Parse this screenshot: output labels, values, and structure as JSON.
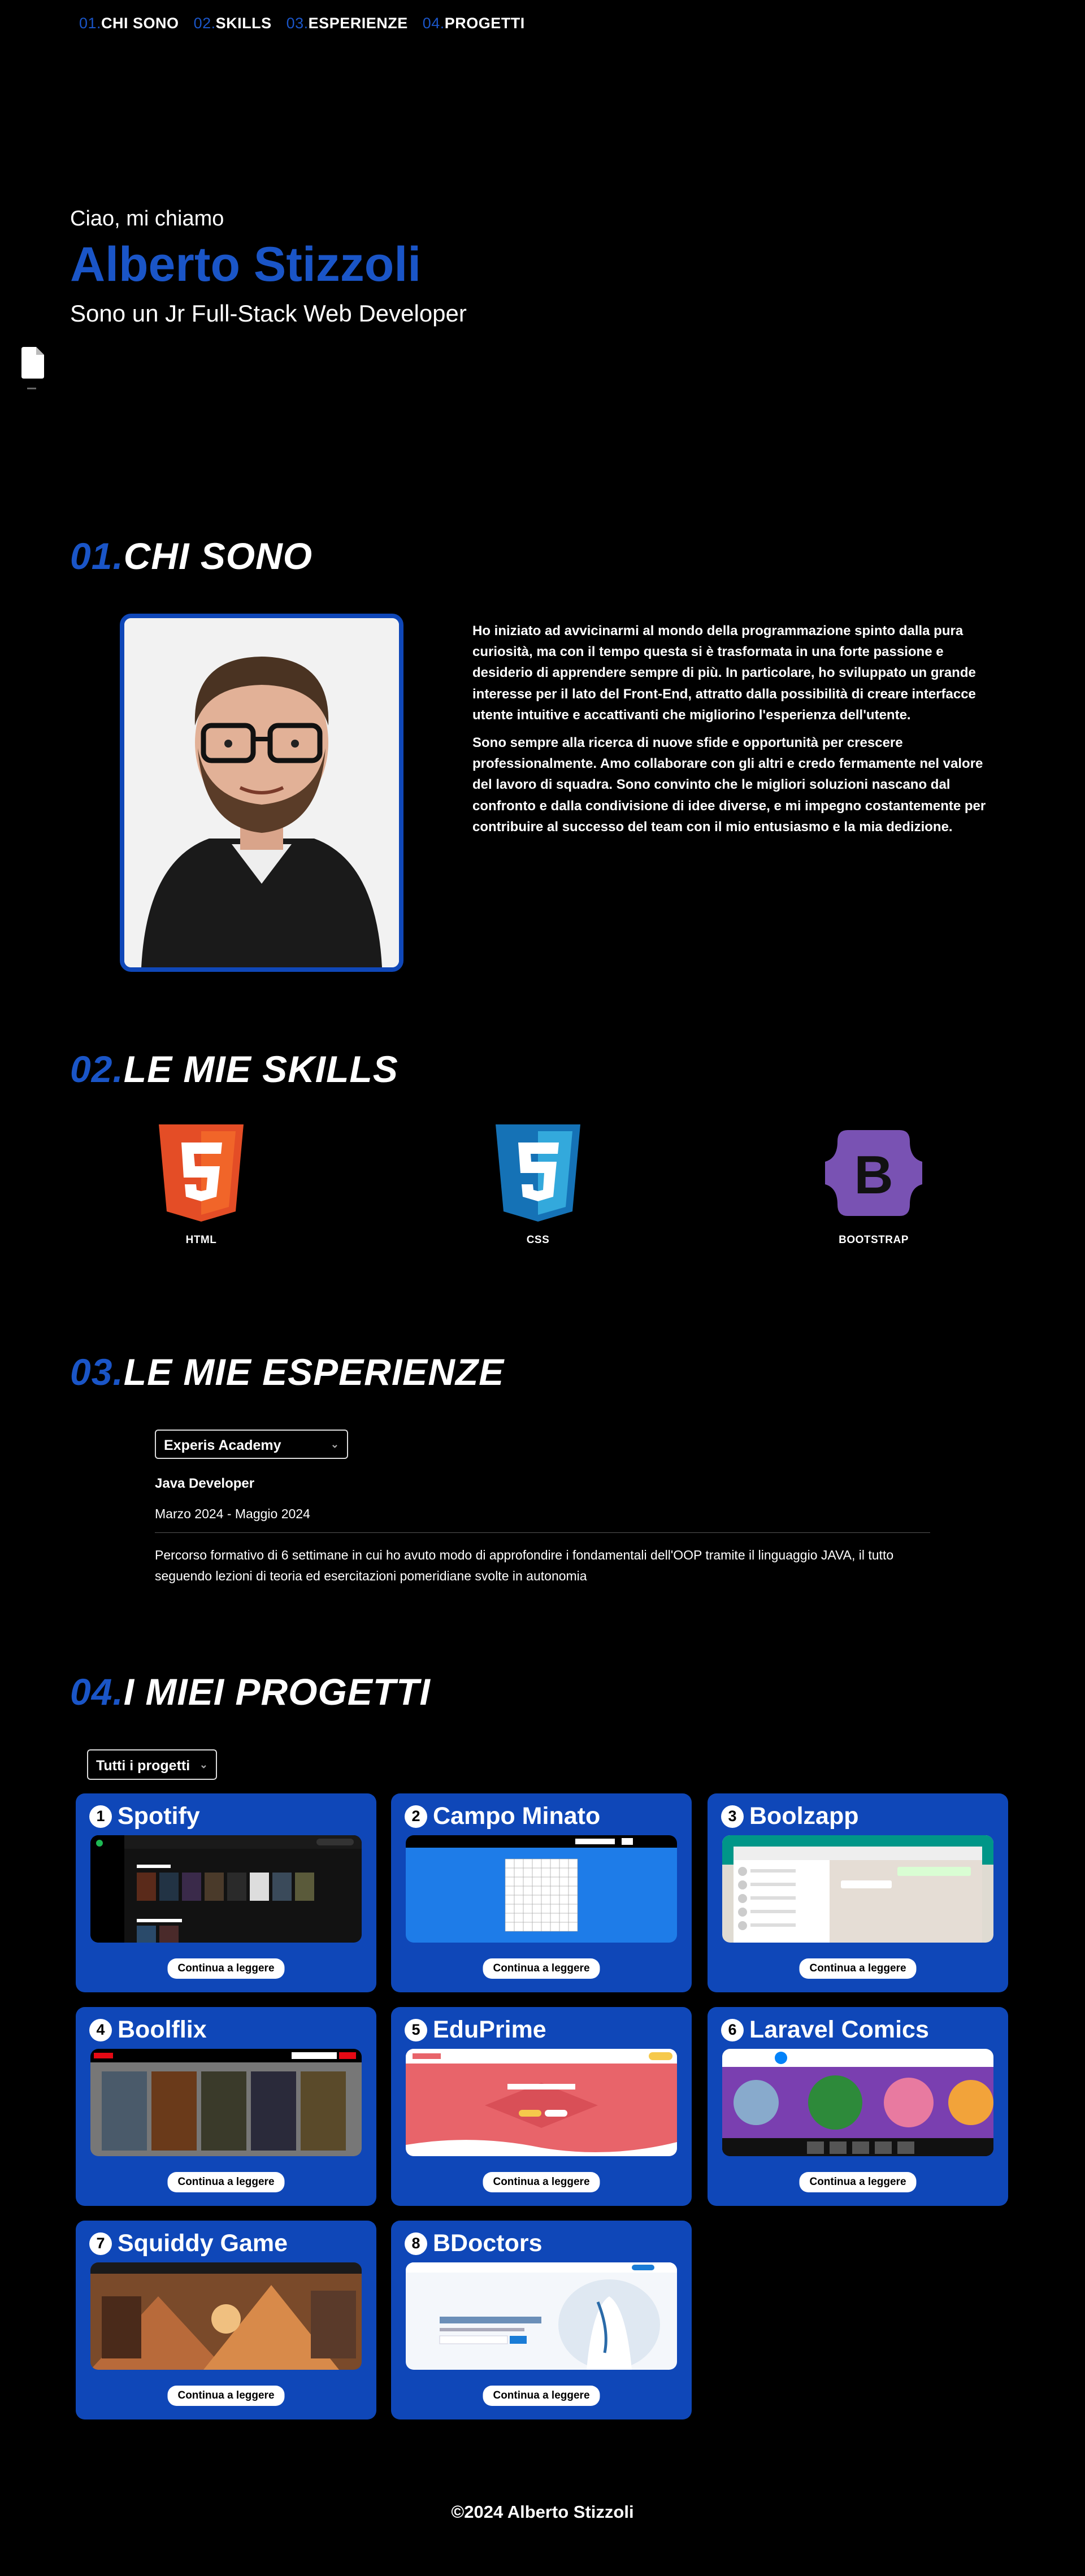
{
  "nav": {
    "items": [
      {
        "num": "01.",
        "label": "CHI SONO"
      },
      {
        "num": "02.",
        "label": "SKILLS"
      },
      {
        "num": "03.",
        "label": "ESPERIENZE"
      },
      {
        "num": "04.",
        "label": "PROGETTI"
      }
    ]
  },
  "hero": {
    "greeting": "Ciao, mi chiamo",
    "name": "Alberto Stizzoli",
    "role": "Sono un Jr Full-Stack Web Developer"
  },
  "about": {
    "num": "01.",
    "title": "CHI SONO",
    "p1": "Ho iniziato ad avvicinarmi al mondo della programmazione spinto dalla pura curiosità, ma con il tempo questa si è trasformata in una forte passione e desiderio di apprendere sempre di più. In particolare, ho sviluppato un grande interesse per il lato del Front-End, attratto dalla possibilità di creare interfacce utente intuitive e accattivanti che migliorino l'esperienza dell'utente.",
    "p2": "Sono sempre alla ricerca di nuove sfide e opportunità per crescere professionalmente. Amo collaborare con gli altri e credo fermamente nel valore del lavoro di squadra. Sono convinto che le migliori soluzioni nascano dal confronto e dalla condivisione di idee diverse, e mi impegno costantemente per contribuire al successo del team con il mio entusiasmo e la mia dedizione."
  },
  "skills": {
    "num": "02.",
    "title": "LE MIE SKILLS",
    "items": [
      {
        "label": "HTML",
        "color": "#e44d26"
      },
      {
        "label": "CSS",
        "color": "#1572b6"
      },
      {
        "label": "BOOTSTRAP",
        "color": "#7952b3"
      }
    ]
  },
  "experience": {
    "num": "03.",
    "title": "LE MIE ESPERIENZE",
    "selected": "Experis Academy",
    "role": "Java Developer",
    "date": "Marzo 2024 - Maggio 2024",
    "description": "Percorso formativo di 6 settimane in cui ho avuto modo di approfondire i fondamentali dell'OOP tramite il linguaggio JAVA, il tutto seguendo lezioni di teoria ed esercitazioni pomeridiane svolte in autonomia"
  },
  "projects": {
    "num": "04.",
    "title": "I MIEI PROGETTI",
    "filter": "Tutti i progetti",
    "button_label": "Continua a leggere",
    "items": [
      {
        "n": "1",
        "title": "Spotify"
      },
      {
        "n": "2",
        "title": "Campo Minato"
      },
      {
        "n": "3",
        "title": "Boolzapp"
      },
      {
        "n": "4",
        "title": "Boolflix"
      },
      {
        "n": "5",
        "title": "EduPrime"
      },
      {
        "n": "6",
        "title": "Laravel Comics"
      },
      {
        "n": "7",
        "title": "Squiddy Game"
      },
      {
        "n": "8",
        "title": "BDoctors"
      }
    ]
  },
  "footer": {
    "text": "©2024 Alberto Stizzoli"
  },
  "colors": {
    "accent": "#1a55c7",
    "card": "#0f47b8",
    "background": "#000000"
  }
}
